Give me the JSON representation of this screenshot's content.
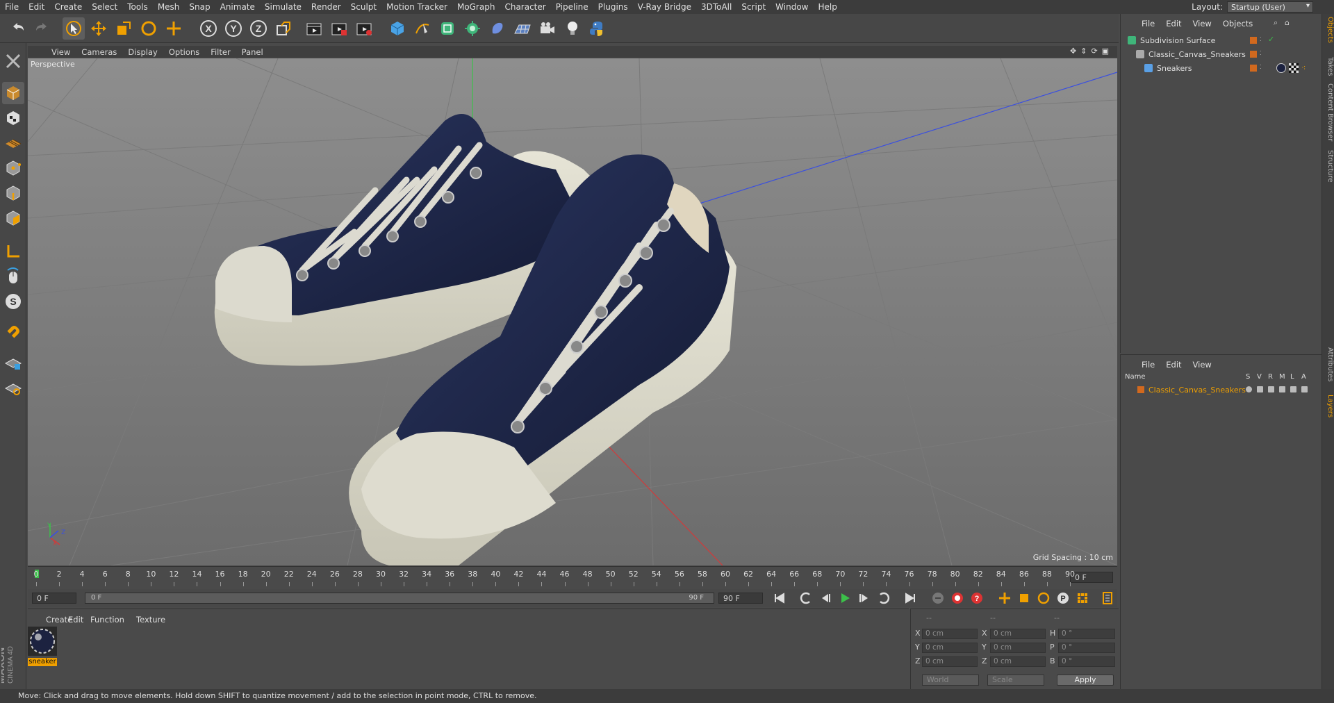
{
  "menubar": {
    "items": [
      "File",
      "Edit",
      "Create",
      "Select",
      "Tools",
      "Mesh",
      "Snap",
      "Animate",
      "Simulate",
      "Render",
      "Sculpt",
      "Motion Tracker",
      "MoGraph",
      "Character",
      "Pipeline",
      "Plugins",
      "V-Ray Bridge",
      "3DToAll",
      "Script",
      "Window",
      "Help"
    ],
    "layout_label": "Layout:",
    "layout_value": "Startup (User)"
  },
  "viewport": {
    "menu": [
      "View",
      "Cameras",
      "Display",
      "Options",
      "Filter",
      "Panel"
    ],
    "mode_label": "Perspective",
    "grid_spacing": "Grid Spacing : 10 cm",
    "axes": {
      "y": "Y",
      "x": "X",
      "z": "Z"
    }
  },
  "timeline": {
    "ticks": [
      "0",
      "2",
      "4",
      "6",
      "8",
      "10",
      "12",
      "14",
      "16",
      "18",
      "20",
      "22",
      "24",
      "26",
      "28",
      "30",
      "32",
      "34",
      "36",
      "38",
      "40",
      "42",
      "44",
      "46",
      "48",
      "50",
      "52",
      "54",
      "56",
      "58",
      "60",
      "62",
      "64",
      "66",
      "68",
      "70",
      "72",
      "74",
      "76",
      "78",
      "80",
      "82",
      "84",
      "86",
      "88",
      "90"
    ],
    "current_frame": "0 F"
  },
  "transport": {
    "start_field": "0 F",
    "range_start": "0 F",
    "range_end": "90 F",
    "end_field": "90 F"
  },
  "material_panel": {
    "menu": [
      "Create",
      "Edit",
      "Function",
      "Texture"
    ],
    "material_name": "sneaker"
  },
  "coords": {
    "header": [
      "--",
      "--",
      "--"
    ],
    "rows": [
      {
        "a": "X",
        "av": "0 cm",
        "b": "X",
        "bv": "0 cm",
        "c": "H",
        "cv": "0 °"
      },
      {
        "a": "Y",
        "av": "0 cm",
        "b": "Y",
        "bv": "0 cm",
        "c": "P",
        "cv": "0 °"
      },
      {
        "a": "Z",
        "av": "0 cm",
        "b": "Z",
        "bv": "0 cm",
        "c": "B",
        "cv": "0 °"
      }
    ],
    "world": "World",
    "scale": "Scale",
    "apply": "Apply"
  },
  "object_manager": {
    "menu": [
      "File",
      "Edit",
      "View",
      "Objects"
    ],
    "objects": [
      {
        "name": "Subdivision Surface",
        "indent": 0
      },
      {
        "name": "Classic_Canvas_Sneakers",
        "indent": 1
      },
      {
        "name": "Sneakers",
        "indent": 2
      }
    ]
  },
  "layer_manager": {
    "menu": [
      "File",
      "Edit",
      "View"
    ],
    "columns": [
      "Name",
      "S",
      "V",
      "R",
      "M",
      "L",
      "A"
    ],
    "layer": "Classic_Canvas_Sneakers",
    "layer_color": "#d2691e"
  },
  "right_tabs": [
    "Objects",
    "Takes",
    "Content Browser",
    "Structure",
    "Attributes",
    "Layers"
  ],
  "brand": {
    "maxon": "MAXON",
    "product": "CINEMA 4D"
  },
  "status": "Move: Click and drag to move elements. Hold down SHIFT to quantize movement / add to the selection in point mode, CTRL to remove.",
  "colors": {
    "accent": "#f0a000",
    "navy": "#1b2240",
    "sole": "#d8d6c8"
  }
}
